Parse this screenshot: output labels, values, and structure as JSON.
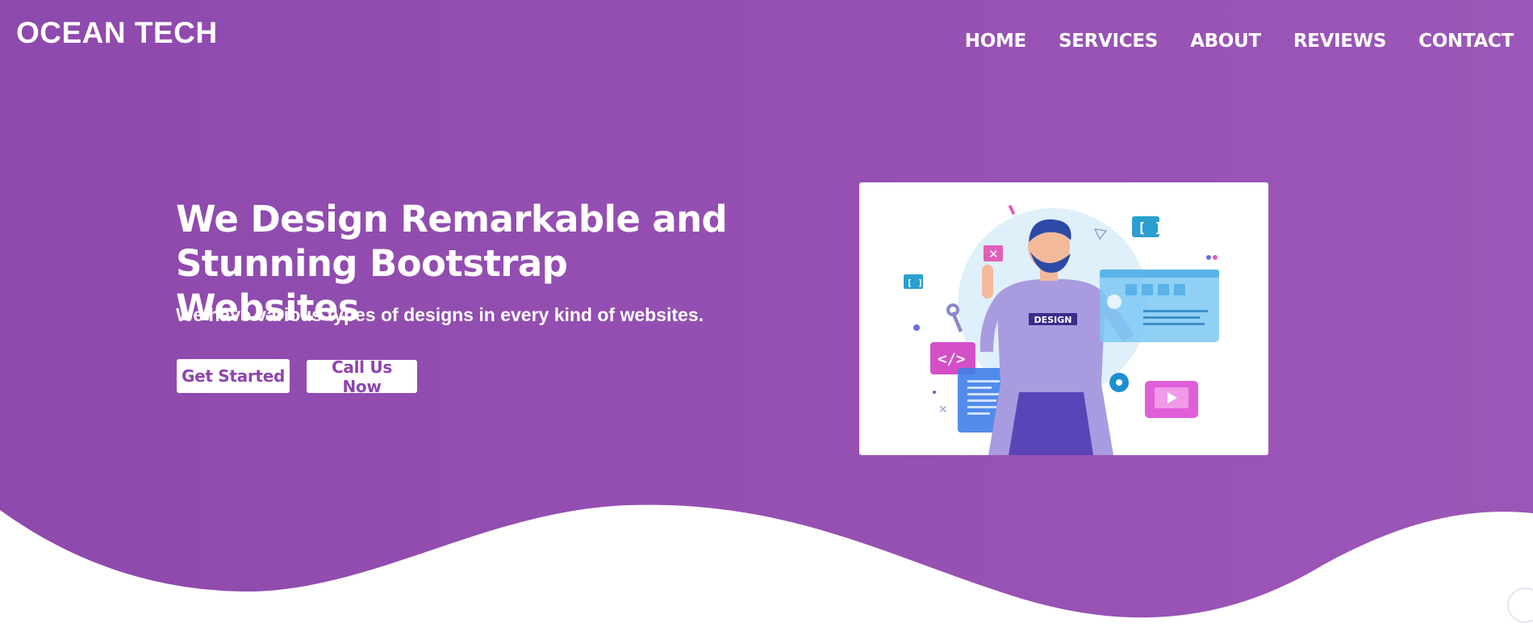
{
  "theme": {
    "primary": "#8e4bb0",
    "primary_light": "#9a55b6",
    "text_on_primary": "#ffffff"
  },
  "header": {
    "brand": "OCEAN TECH",
    "nav": [
      "HOME",
      "SERVICES",
      "ABOUT",
      "REVIEWS",
      "CONTACT"
    ]
  },
  "hero": {
    "headline": "We Design Remarkable and Stunning Bootstrap Websites",
    "subtitle": "We have various types of designs in every kind of websites.",
    "buttons": {
      "primary": "Get Started",
      "secondary": "Call Us Now"
    },
    "illustration_badge": "DESIGN"
  },
  "widgets": {
    "chat_icon": "chat-bot-icon"
  }
}
